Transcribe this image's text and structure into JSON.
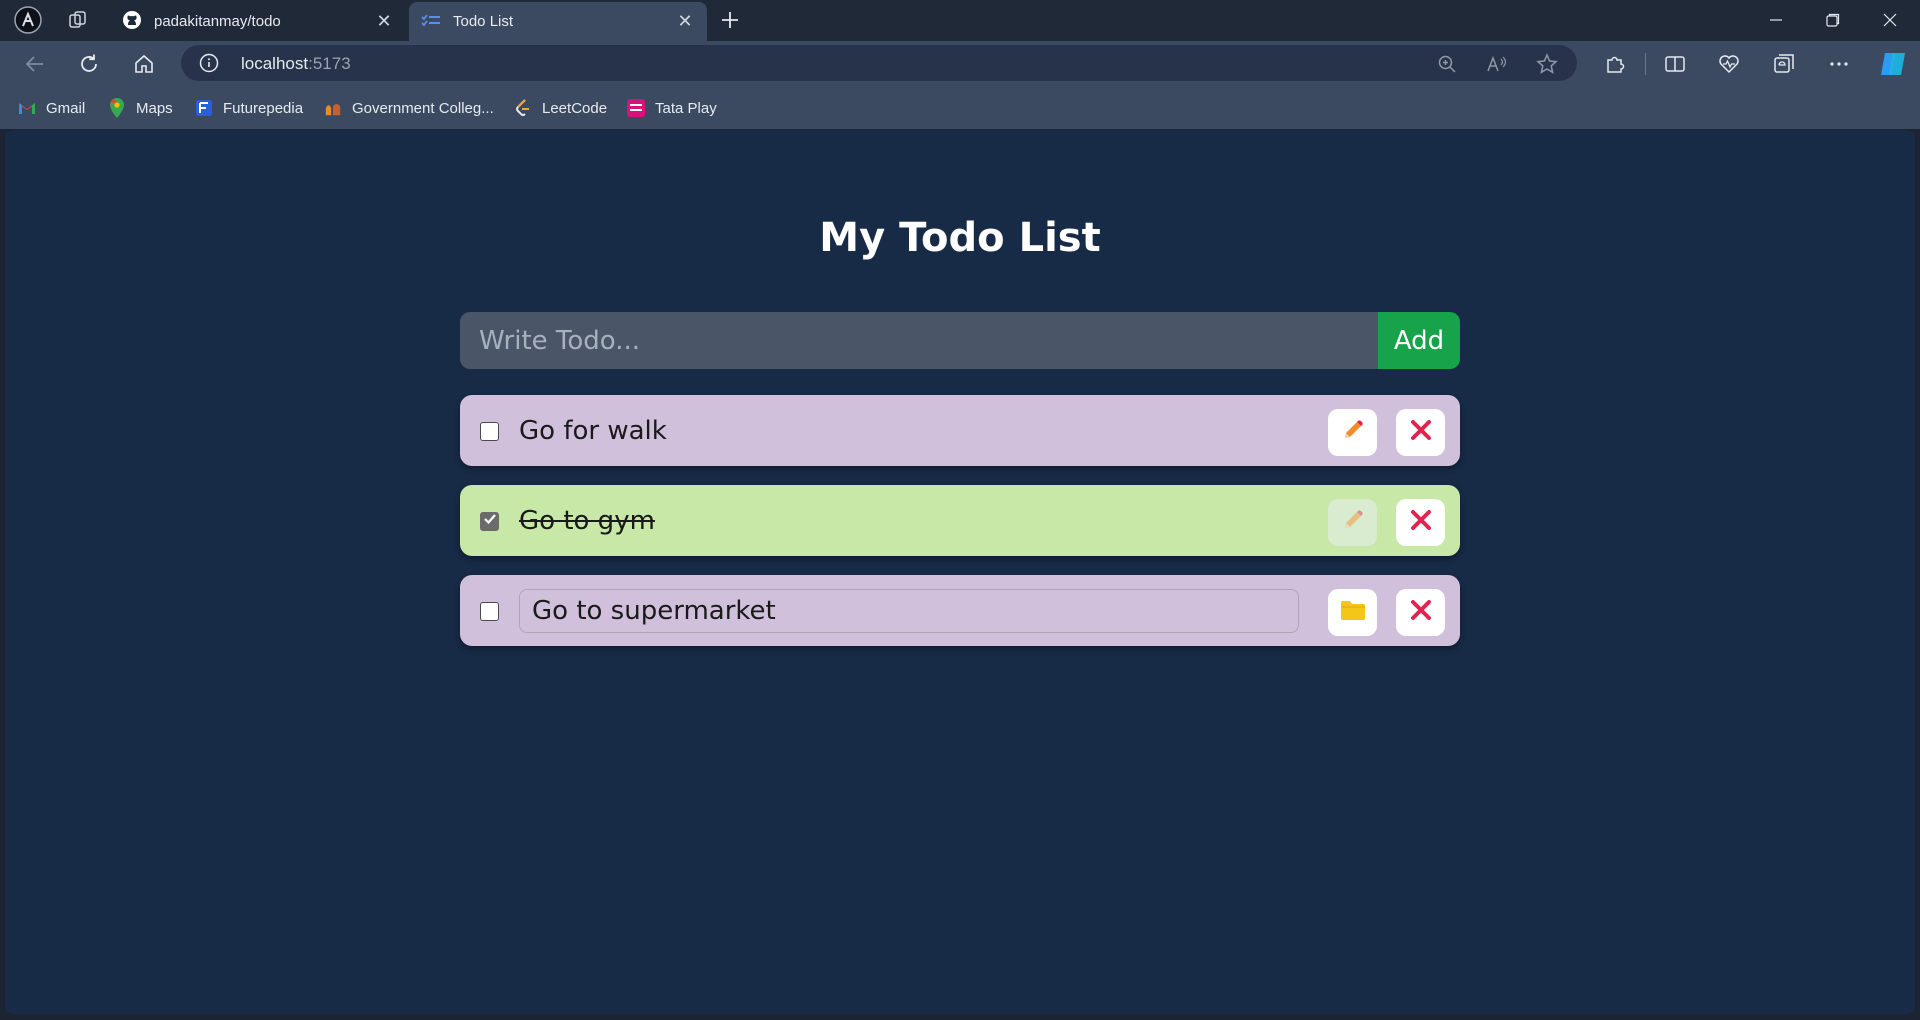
{
  "browser": {
    "tabs": [
      {
        "title": "padakitanmay/todo",
        "active": false
      },
      {
        "title": "Todo List",
        "active": true
      }
    ],
    "url_host": "localhost",
    "url_port": ":5173",
    "bookmarks": [
      {
        "label": "Gmail",
        "icon": "gmail-icon"
      },
      {
        "label": "Maps",
        "icon": "maps-icon"
      },
      {
        "label": "Futurepedia",
        "icon": "futurepedia-icon"
      },
      {
        "label": "Government Colleg...",
        "icon": "college-icon"
      },
      {
        "label": "LeetCode",
        "icon": "leetcode-icon"
      },
      {
        "label": "Tata Play",
        "icon": "tataplay-icon"
      }
    ]
  },
  "app": {
    "title": "My Todo List",
    "input_placeholder": "Write Todo...",
    "add_label": "Add",
    "todos": [
      {
        "text": "Go for walk",
        "completed": false,
        "editing": false,
        "color": "#d1c0dc"
      },
      {
        "text": "Go to gym",
        "completed": true,
        "editing": false,
        "color": "#c8e8a7"
      },
      {
        "text": "Go to supermarket",
        "completed": false,
        "editing": true,
        "color": "#d1c0dc"
      }
    ]
  },
  "colors": {
    "add_button": "#16a34a",
    "delete_icon": "#e0244e",
    "edit_icon": "#f28c28",
    "save_icon": "#f5c518"
  }
}
